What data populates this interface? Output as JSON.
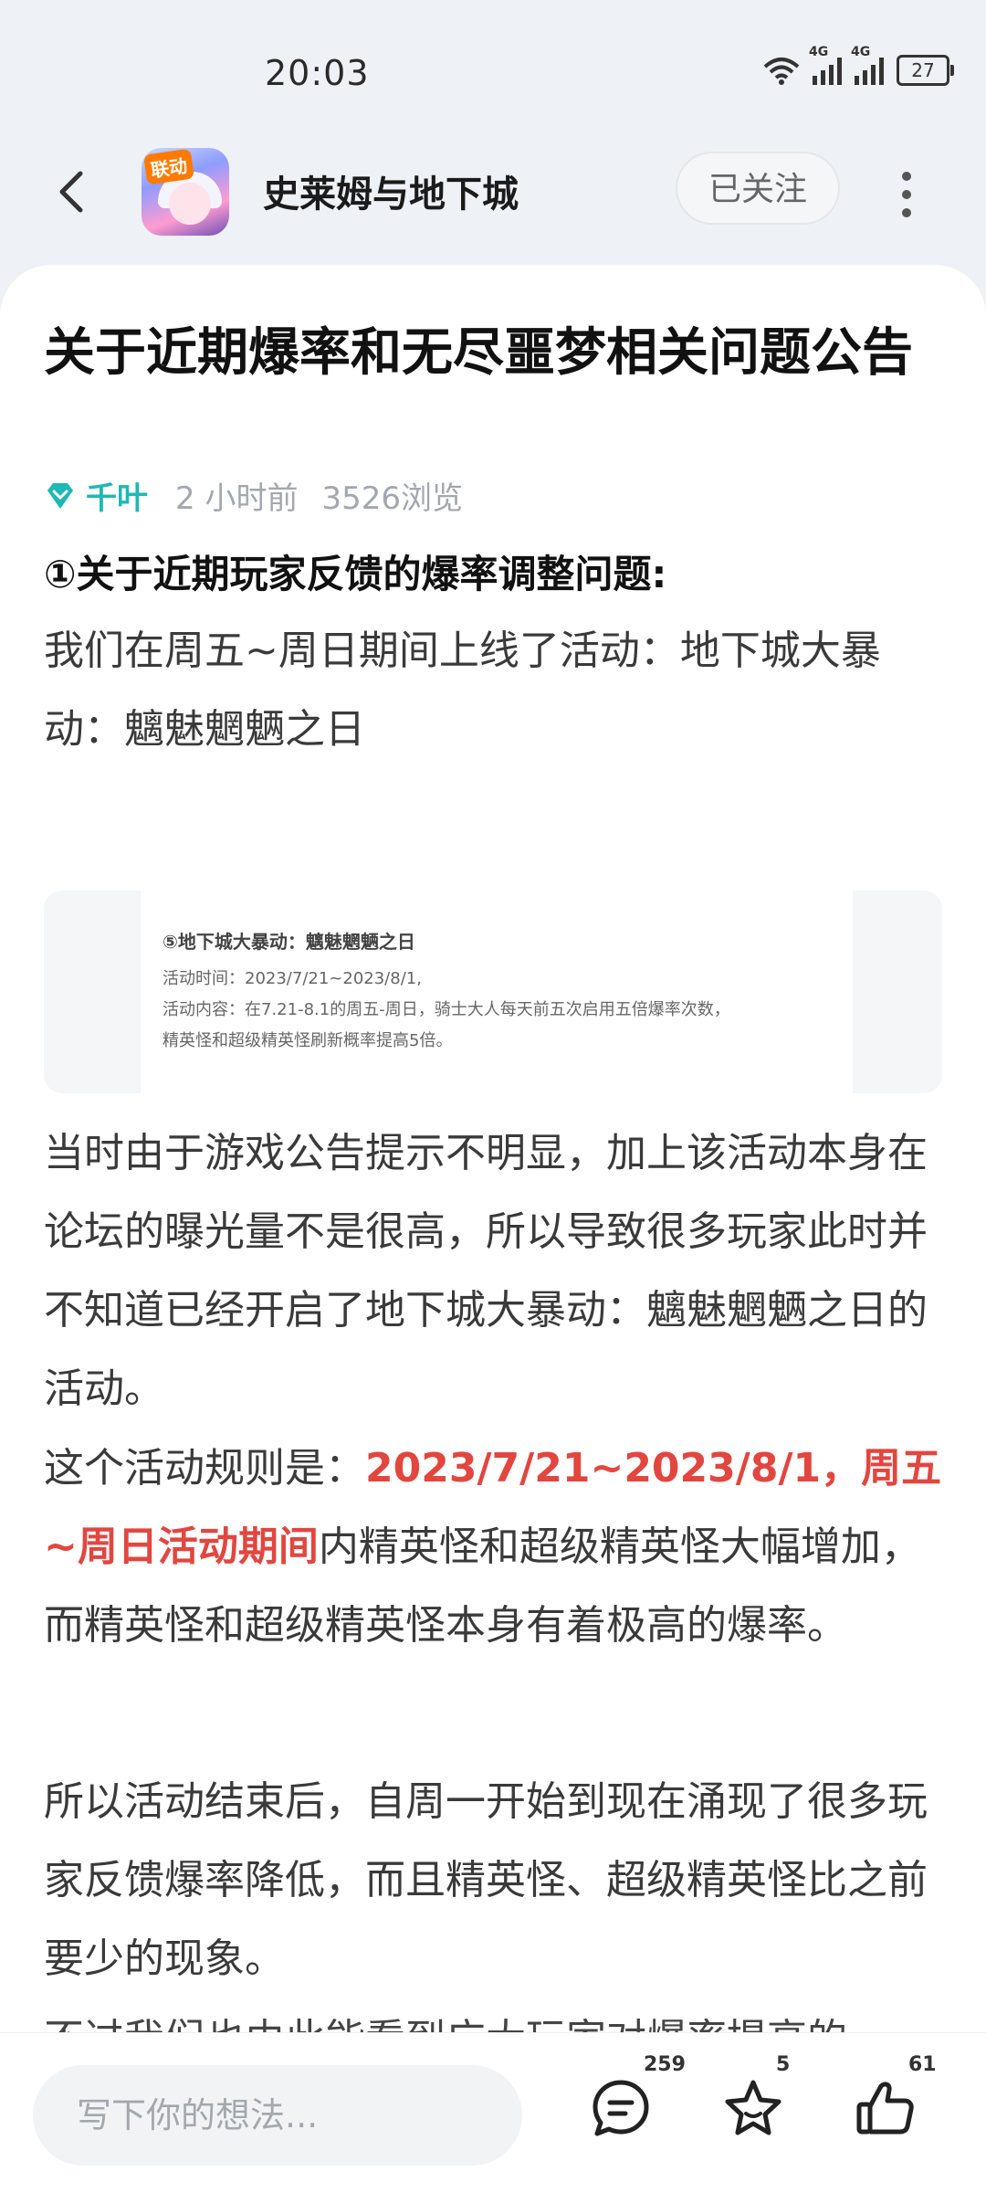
{
  "status_bar": {
    "time": "20:03",
    "net1": "4G",
    "net2": "4G",
    "battery": "27"
  },
  "header": {
    "app_name": "史莱姆与地下城",
    "app_badge": "联动",
    "follow_label": "已关注"
  },
  "post": {
    "title": "关于近期爆率和无尽噩梦相关问题公告",
    "author": "千叶",
    "time_ago": "2 小时前",
    "views": "3526浏览",
    "section1_heading": "①关于近期玩家反馈的爆率调整问题:",
    "para1": "我们在周五~周日期间上线了活动：地下城大暴动：魑魅魍魉之日",
    "embedded_image": {
      "line1": "⑤地下城大暴动：魑魅魍魉之日",
      "line2": "活动时间：2023/7/21~2023/8/1,",
      "line3": "活动内容：在7.21-8.1的周五-周日，骑士大人每天前五次启用五倍爆率次数，",
      "line4": "精英怪和超级精英怪刷新概率提高5倍。"
    },
    "para2": "当时由于游戏公告提示不明显，加上该活动本身在论坛的曝光量不是很高，所以导致很多玩家此时并不知道已经开启了地下城大暴动：魑魅魍魉之日的活动。",
    "para3_prefix": "这个活动规则是：",
    "para3_highlight": "2023/7/21~2023/8/1，周五~周日活动期间",
    "para3_suffix": "内精英怪和超级精英怪大幅增加，而精英怪和超级精英怪本身有着极高的爆率。",
    "para4": "所以活动结束后，自周一开始到现在涌现了很多玩家反馈爆率降低，而且精英怪、超级精英怪比之前要少的现象。",
    "para5": "不过我们也由此能看到广大玩家对爆率提高的"
  },
  "bottom_bar": {
    "input_placeholder": "写下你的想法...",
    "comment_count": "259",
    "favorite_count": "5",
    "like_count": "61"
  },
  "colors": {
    "accent_teal": "#1fb8b4",
    "highlight_red": "#e2463f"
  }
}
